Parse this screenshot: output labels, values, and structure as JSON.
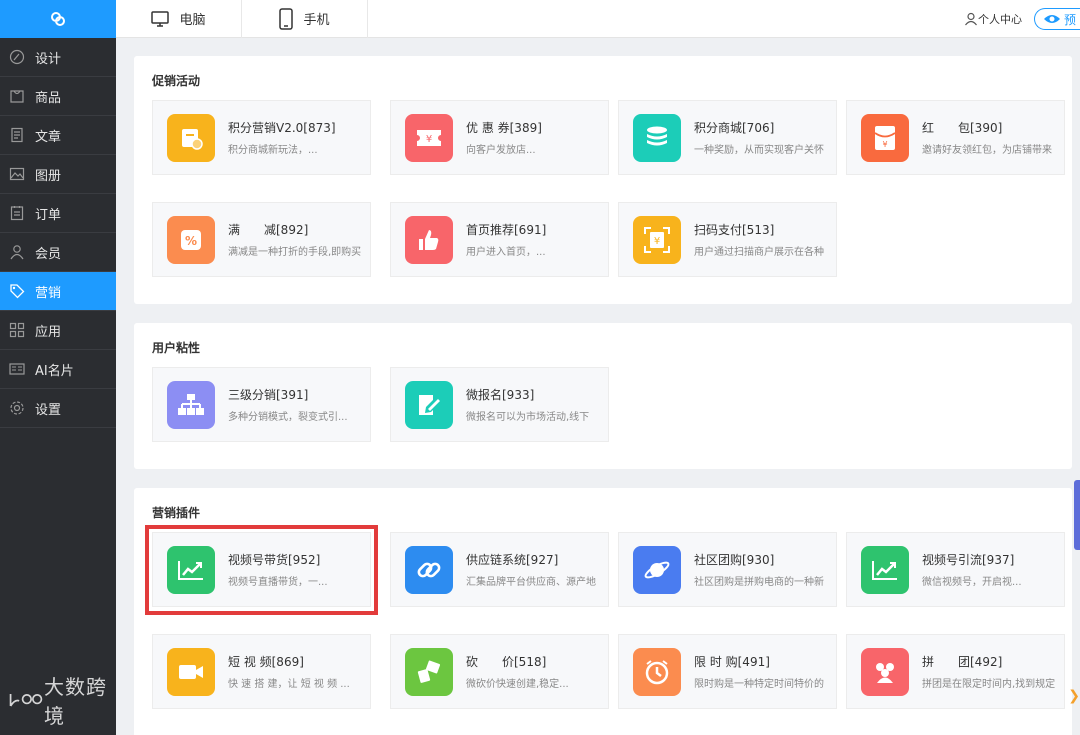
{
  "sidebar": {
    "items": [
      {
        "label": "设计",
        "icon": "design-icon"
      },
      {
        "label": "商品",
        "icon": "goods-icon"
      },
      {
        "label": "文章",
        "icon": "article-icon"
      },
      {
        "label": "图册",
        "icon": "album-icon"
      },
      {
        "label": "订单",
        "icon": "order-icon"
      },
      {
        "label": "会员",
        "icon": "member-icon"
      },
      {
        "label": "营销",
        "icon": "tag-icon"
      },
      {
        "label": "应用",
        "icon": "apps-icon"
      },
      {
        "label": "AI名片",
        "icon": "card-icon"
      },
      {
        "label": "设置",
        "icon": "gear-icon"
      }
    ],
    "active": "营销",
    "watermark": "大数跨境"
  },
  "topbar": {
    "tabs": [
      {
        "label": "电脑",
        "icon": "monitor-icon"
      },
      {
        "label": "手机",
        "icon": "phone-icon"
      }
    ],
    "user_center": "个人中心",
    "preview": "预"
  },
  "sections": [
    {
      "title": "促销活动",
      "cards": [
        {
          "title": "积分营销V2.0[873]",
          "desc": "积分商城新玩法，...",
          "color": "#f8b31c",
          "icon": "points-icon"
        },
        {
          "title": "优 惠 券[389]",
          "desc": "向客户发放店...",
          "color": "#f8656a",
          "icon": "coupon-icon"
        },
        {
          "title": "积分商城[706]",
          "desc": "一种奖励，从而实现客户关怀",
          "color": "#1ccdb8",
          "icon": "coins-icon"
        },
        {
          "title": "红　　包[390]",
          "desc": "邀请好友领红包，为店铺带来",
          "color": "#f96a3e",
          "icon": "redpacket-icon"
        },
        {
          "title": "满　　减[892]",
          "desc": "满减是一种打折的手段,即购买",
          "color": "#fb8c4f",
          "icon": "discount-icon"
        },
        {
          "title": "首页推荐[691]",
          "desc": "用户进入首页，...",
          "color": "#f8656a",
          "icon": "thumbs-up-icon"
        },
        {
          "title": "扫码支付[513]",
          "desc": "用户通过扫描商户展示在各种",
          "color": "#f8b31c",
          "icon": "scan-pay-icon"
        }
      ]
    },
    {
      "title": "用户粘性",
      "cards": [
        {
          "title": "三级分销[391]",
          "desc": "多种分销模式，裂变式引...",
          "color": "#8c8ef3",
          "icon": "hierarchy-icon"
        },
        {
          "title": "微报名[933]",
          "desc": "微报名可以为市场活动,线下",
          "color": "#1ccdb8",
          "icon": "signup-icon"
        }
      ]
    },
    {
      "title": "营销插件",
      "cards": [
        {
          "title": "视频号带货[952]",
          "desc": "视频号直播带货，一...",
          "color": "#2ec36e",
          "icon": "trend-icon"
        },
        {
          "title": "供应链系统[927]",
          "desc": "汇集品牌平台供应商、源产地",
          "color": "#2d8cf0",
          "icon": "link-icon"
        },
        {
          "title": "社区团购[930]",
          "desc": "社区团购是拼购电商的一种新",
          "color": "#4a7cf0",
          "icon": "planet-icon"
        },
        {
          "title": "视频号引流[937]",
          "desc": "微信视频号，开启视...",
          "color": "#2ec36e",
          "icon": "trend-icon"
        },
        {
          "title": "短 视 频[869]",
          "desc": "快 速 搭 建，让 短 视 频 ...",
          "color": "#f8b31c",
          "icon": "video-icon"
        },
        {
          "title": "砍　　价[518]",
          "desc": "微砍价快速创建,稳定...",
          "color": "#6cc640",
          "icon": "bargain-icon"
        },
        {
          "title": "限 时 购[491]",
          "desc": "限时购是一种特定时间特价的",
          "color": "#fb8c4f",
          "icon": "clock-icon"
        },
        {
          "title": "拼　　团[492]",
          "desc": "拼团是在限定时间内,找到规定",
          "color": "#f8656a",
          "icon": "group-icon"
        }
      ]
    }
  ]
}
